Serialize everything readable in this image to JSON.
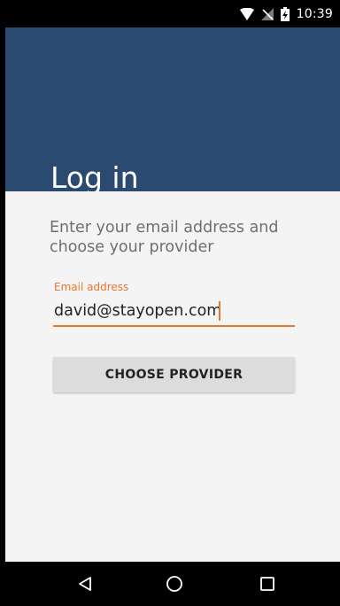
{
  "status_bar": {
    "time": "10:39",
    "icons": [
      "wifi-icon",
      "no-signal-icon",
      "battery-charging-icon"
    ]
  },
  "app_bar": {
    "title": "Log in",
    "color": "#2b4a6f"
  },
  "form": {
    "intro": "Enter your email address and choose your provider",
    "email_label": "Email address",
    "email_value": "david@stayopen.com",
    "accent_color": "#e8772e",
    "submit_label": "CHOOSE PROVIDER"
  },
  "nav_bar": {
    "buttons": [
      "back-icon",
      "home-icon",
      "recents-icon"
    ]
  }
}
